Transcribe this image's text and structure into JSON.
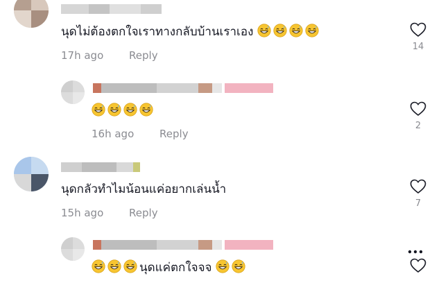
{
  "comments": [
    {
      "text": "นุดไม่ต้องตกใจเราทางกลับบ้านเราเอง",
      "emoji_count": 4,
      "time": "17h ago",
      "reply": "Reply",
      "likes": "14"
    },
    {
      "text": "",
      "emoji_count": 4,
      "time": "16h ago",
      "reply": "Reply",
      "likes": "2"
    },
    {
      "text": "นุดกลัวทำไมน้อนแค่อยากเล่นน้ำ",
      "emoji_count": 0,
      "time": "15h ago",
      "reply": "Reply",
      "likes": "7"
    },
    {
      "text_pre_emoji_count": 3,
      "text": "นุดแค่ตกใจจจ",
      "emoji_count": 2
    }
  ],
  "icons": {
    "like": "heart-outline-icon",
    "more": "more-horizontal-icon",
    "emoji": "grinning-sweat-emoji"
  },
  "colors": {
    "text": "#161823",
    "meta": "#8a8b91",
    "emoji_face": "#f7c531"
  }
}
